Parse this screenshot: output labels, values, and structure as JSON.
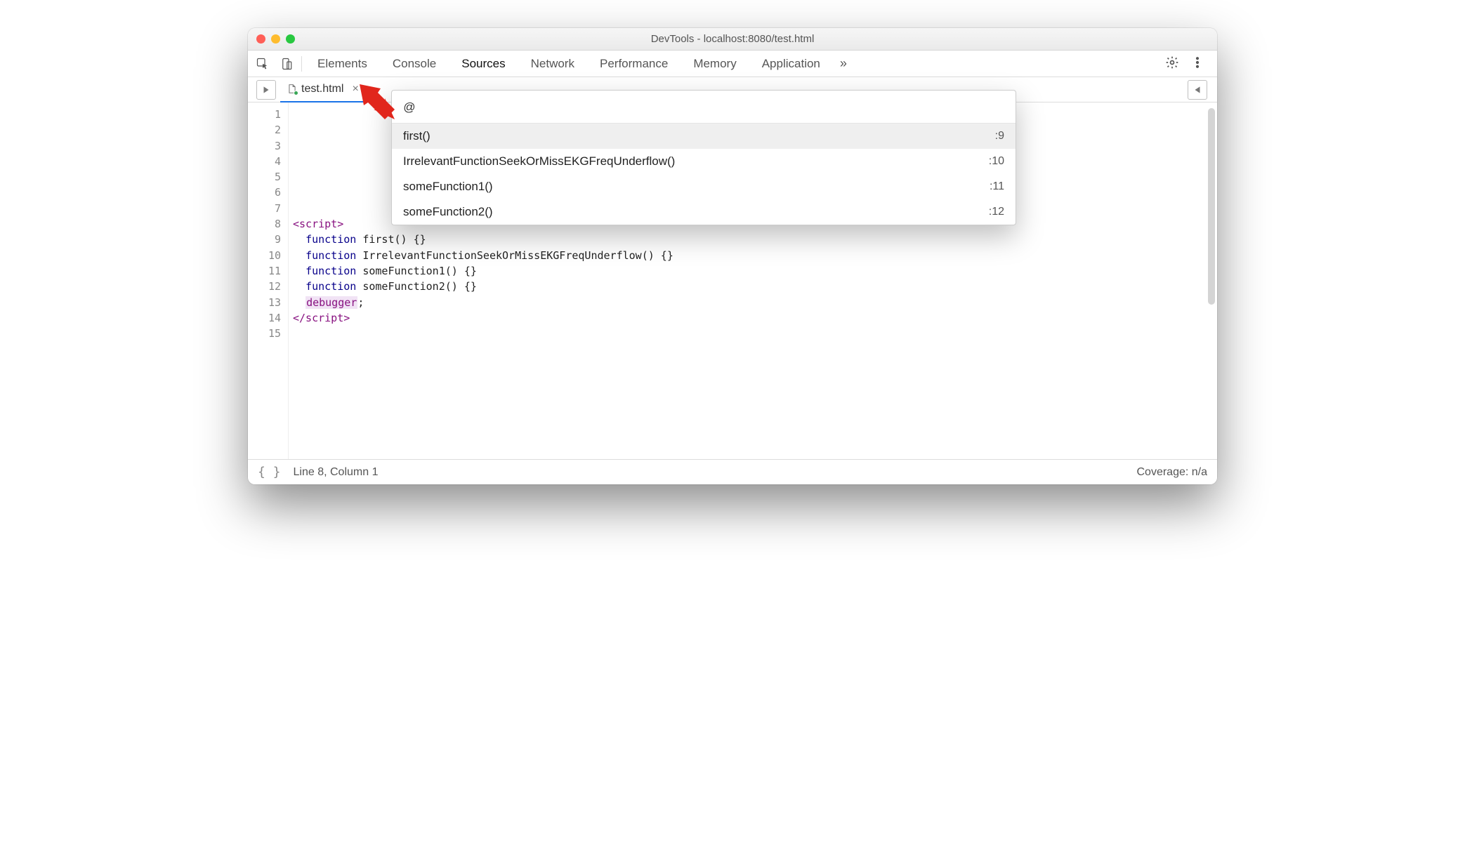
{
  "window": {
    "title": "DevTools - localhost:8080/test.html"
  },
  "tabsbar": {
    "items": [
      {
        "label": "Elements",
        "active": false
      },
      {
        "label": "Console",
        "active": false
      },
      {
        "label": "Sources",
        "active": true
      },
      {
        "label": "Network",
        "active": false
      },
      {
        "label": "Performance",
        "active": false
      },
      {
        "label": "Memory",
        "active": false
      },
      {
        "label": "Application",
        "active": false
      }
    ]
  },
  "filetab": {
    "name": "test.html"
  },
  "quickopen": {
    "query": "@",
    "items": [
      {
        "label": "first()",
        "loc": ":9",
        "selected": true
      },
      {
        "label": "IrrelevantFunctionSeekOrMissEKGFreqUnderflow()",
        "loc": ":10",
        "selected": false
      },
      {
        "label": "someFunction1()",
        "loc": ":11",
        "selected": false
      },
      {
        "label": "someFunction2()",
        "loc": ":12",
        "selected": false
      }
    ]
  },
  "code": {
    "lines": [
      "",
      "",
      "",
      "",
      "",
      "",
      "",
      "<script>",
      "  function first() {}",
      "  function IrrelevantFunctionSeekOrMissEKGFreqUnderflow() {}",
      "  function someFunction1() {}",
      "  function someFunction2() {}",
      "  debugger;",
      "</__script__>",
      ""
    ],
    "line_count": 15
  },
  "status": {
    "cursor": "Line 8, Column 1",
    "coverage": "Coverage: n/a"
  }
}
